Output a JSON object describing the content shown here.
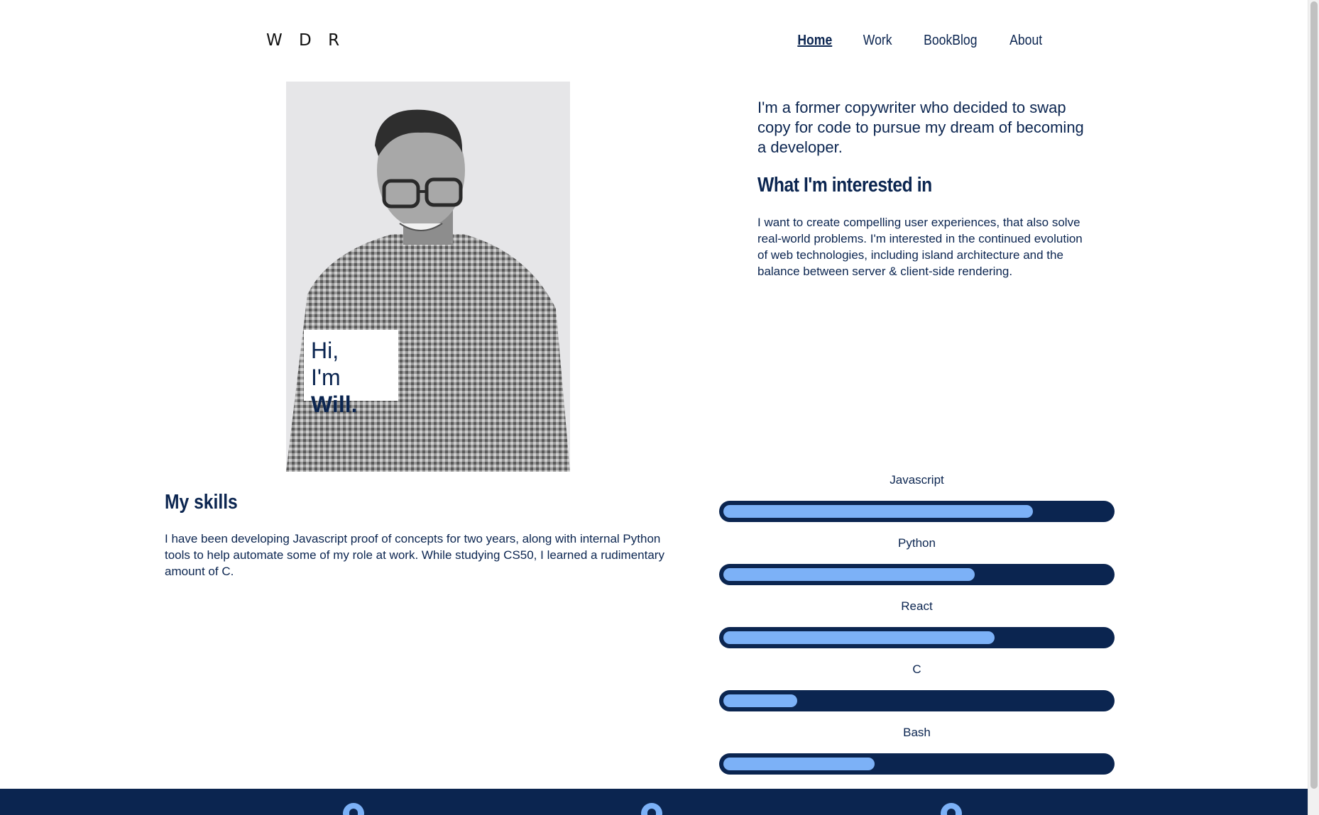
{
  "header": {
    "logo": "W D R",
    "nav": [
      {
        "label": "Home",
        "active": true
      },
      {
        "label": "Work",
        "active": false
      },
      {
        "label": "BookBlog",
        "active": false
      },
      {
        "label": "About",
        "active": false
      }
    ]
  },
  "hero": {
    "greeting_line1": "Hi,",
    "greeting_prefix": "I'm ",
    "greeting_name": "Will."
  },
  "intro": {
    "text": "I'm a former copywriter who decided to swap copy for code to pursue my dream of becoming a developer.",
    "interest_heading": "What I'm interested in",
    "interest_text": "I want to create compelling user experiences, that also solve real-world problems. I'm interested in the continued evolution of web technologies, including island architecture and the balance between server & client-side rendering."
  },
  "skills_section": {
    "heading": "My skills",
    "text": "I have been developing Javascript proof of concepts for two years, along with internal Python tools to help automate some of my role at work. While studying CS50, I learned a rudimentary amount of C."
  },
  "skills": [
    {
      "name": "Javascript",
      "level": 0.8
    },
    {
      "name": "Python",
      "level": 0.65
    },
    {
      "name": "React",
      "level": 0.7
    },
    {
      "name": "C",
      "level": 0.19
    },
    {
      "name": "Bash",
      "level": 0.39
    }
  ],
  "footer": {
    "icons": [
      "github-icon",
      "linkedin-icon",
      "spotify-icon"
    ]
  },
  "colors": {
    "navy": "#0b2550",
    "accent": "#7cb1f7"
  }
}
